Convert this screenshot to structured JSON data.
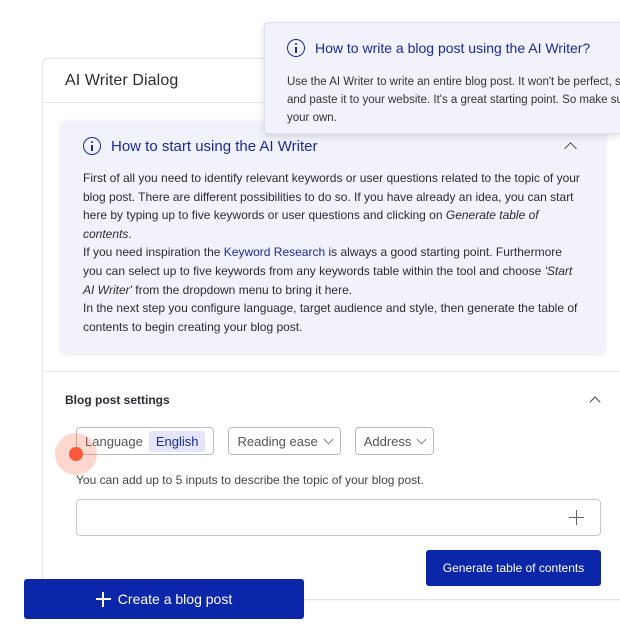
{
  "dialog": {
    "title": "AI Writer Dialog"
  },
  "info_box": {
    "title": "How to start using the AI Writer",
    "p1_a": "First of all you need to identify relevant keywords or user questions related to the topic of your blog post. There are different possibilities to do so. If you have already an idea, you can start here by typing up to five keywords or user questions and clicking on ",
    "p1_em": "Generate table of contents",
    "p1_b": ".",
    "p2_a": "If you need inspiration the ",
    "p2_link": "Keyword Research",
    "p2_b": " is always a good starting point. Furthermore you can select up to five keywords from any keywords table within the tool and choose ",
    "p2_em": "'Start AI Writer'",
    "p2_c": " from the dropdown menu to bring it here.",
    "p3": "In the next step you configure language, target audience and style, then generate the table of contents to begin creating your blog post."
  },
  "settings": {
    "title": "Blog post settings",
    "language_label": "Language",
    "language_value": "English",
    "reading_ease_label": "Reading ease",
    "address_label": "Address",
    "hint": "You can add up to 5 inputs to describe the topic of your blog post.",
    "topic_value": "",
    "topic_placeholder": "",
    "generate_label": "Generate table of contents"
  },
  "create_button": {
    "label": "Create a blog post"
  },
  "tooltip": {
    "title": "How to write a blog post using the AI Writer?",
    "line1": "Use the AI Writer to write an entire blog post. It won't be perfect, s",
    "line2": "and paste it to your website. It's a great starting point. So make su",
    "line3": "your own."
  },
  "colors": {
    "primary": "#0b26a8",
    "info_bg": "#f2f2fc",
    "cursor": "#ff5a3c"
  }
}
